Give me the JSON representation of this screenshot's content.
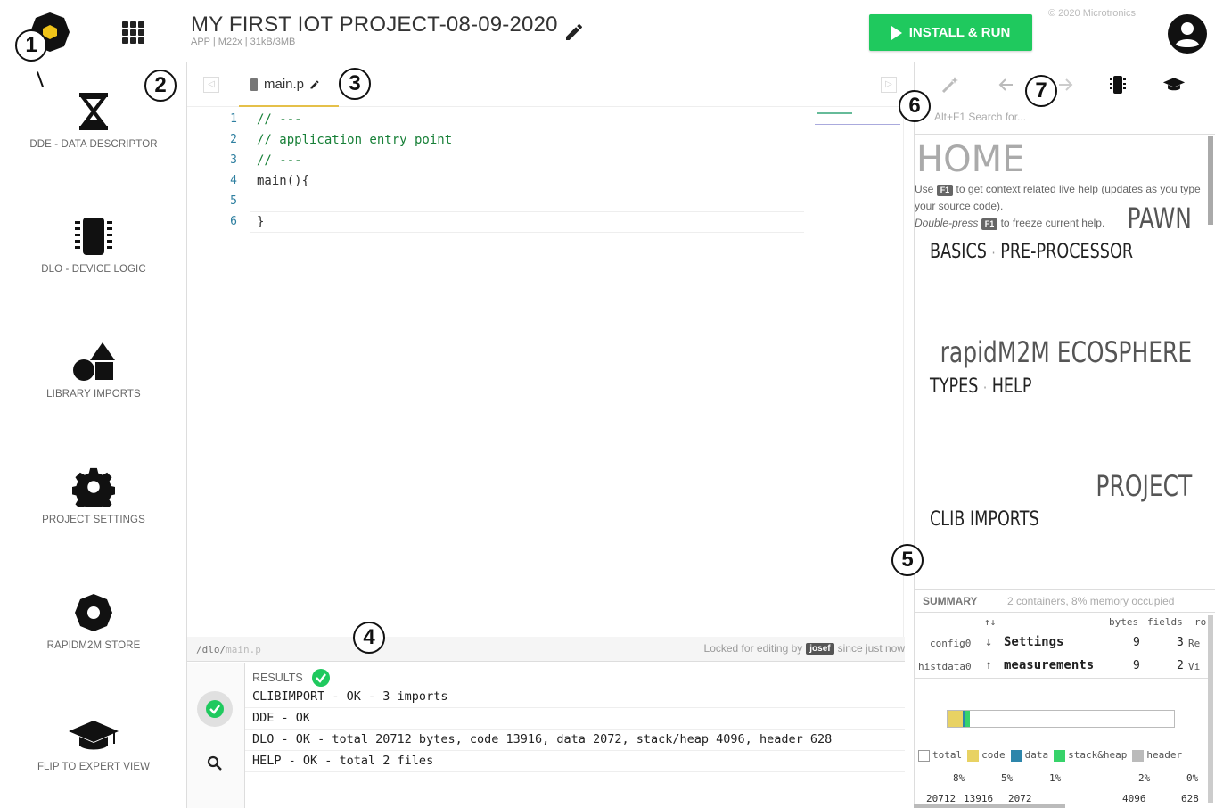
{
  "header": {
    "project_title": "MY FIRST IOT PROJECT-08-09-2020",
    "project_sub": "APP | M22x | 31kB/3MB",
    "install_label": "INSTALL & RUN",
    "copyright": "© 2020 Microtronics",
    "icons": [
      "app-logo-icon",
      "apps-grid-icon",
      "pencil-icon",
      "play-icon",
      "user-avatar-icon"
    ],
    "accent_color": "#1fc95e"
  },
  "sidebar": {
    "items": [
      {
        "label": "DDE - DATA DESCRIPTOR",
        "icon": "hourglass-icon"
      },
      {
        "label": "DLO - DEVICE LOGIC",
        "icon": "chip-icon"
      },
      {
        "label": "LIBRARY IMPORTS",
        "icon": "shapes-icon"
      },
      {
        "label": "PROJECT SETTINGS",
        "icon": "gear-icon"
      },
      {
        "label": "RAPIDM2M STORE",
        "icon": "store-icon"
      },
      {
        "label": "FLIP TO EXPERT VIEW",
        "icon": "graduation-cap-icon"
      }
    ]
  },
  "editor": {
    "tab_label": "main.p",
    "lines": [
      {
        "n": "1",
        "text": "// ---",
        "type": "comment"
      },
      {
        "n": "2",
        "text": "// application entry point",
        "type": "comment"
      },
      {
        "n": "3",
        "text": "// ---",
        "type": "comment"
      },
      {
        "n": "4",
        "text": "main(){",
        "type": "code"
      },
      {
        "n": "5",
        "text": "",
        "type": "code"
      },
      {
        "n": "6",
        "text": "}",
        "type": "code"
      }
    ],
    "path_prefix": "/dlo/",
    "path_file": "main.p",
    "locked_prefix": "Locked for editing by",
    "locked_user": "josef",
    "locked_suffix": "since just now"
  },
  "results": {
    "title": "RESULTS",
    "rows": [
      "CLIBIMPORT - OK - 3 imports",
      "DDE - OK",
      "DLO - OK - total 20712 bytes, code 13916, data 2072, stack/heap 4096, header 628",
      "HELP - OK - total 2 files"
    ]
  },
  "help": {
    "search_placeholder": "Alt+F1 Search for...",
    "home": "HOME",
    "desc_1": "Use",
    "key": "F1",
    "desc_2": "to get context related live help (updates as you type your source code).",
    "desc_3": "Double-press",
    "desc_4": "to freeze current help.",
    "pawn": "PAWN",
    "basics": "BASICS",
    "preprocessor": "PRE-PROCESSOR",
    "ecosphere": "rapidM2M ECOSPHERE",
    "types": "TYPES",
    "help": "HELP",
    "project": "PROJECT",
    "clib": "CLIB IMPORTS",
    "toolbar_icons": [
      "magic-wand-icon",
      "back-arrow-icon",
      "forward-arrow-icon",
      "chip-icon",
      "graduation-cap-icon"
    ]
  },
  "summary": {
    "title": "SUMMARY",
    "desc": "2 containers, 8% memory occupied",
    "sort_icon": "↑↓",
    "headers": [
      "bytes",
      "fields",
      "ro"
    ],
    "rows": [
      {
        "id": "config0",
        "dir": "↓",
        "name": "Settings",
        "bytes": "9",
        "fields": "3",
        "extra": "Re"
      },
      {
        "id": "histdata0",
        "dir": "↑",
        "name": "measurements",
        "bytes": "9",
        "fields": "2",
        "extra": "Vi"
      }
    ],
    "memory_fractions": {
      "code": 0.067,
      "data": 0.01,
      "stack_heap": 0.02
    },
    "legend": [
      "total",
      "code",
      "data",
      "stack&heap",
      "header"
    ],
    "legend_colors": [
      "#ffffff",
      "#e8d263",
      "#2e86ab",
      "#37d36a",
      "#bbbbbb"
    ],
    "percents": [
      "8%",
      "5%",
      "1%",
      "2%",
      "0%"
    ],
    "bytes_row": [
      "20712",
      "13916",
      "2072",
      "4096",
      "628"
    ]
  },
  "annotations": [
    "1",
    "2",
    "3",
    "4",
    "5",
    "6",
    "7"
  ]
}
